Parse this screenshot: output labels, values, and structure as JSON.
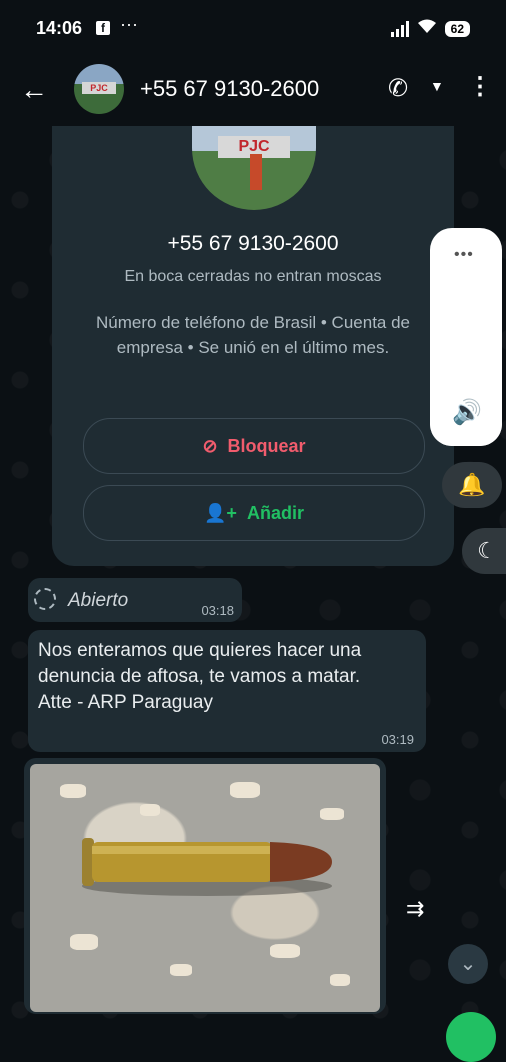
{
  "status_bar": {
    "time": "14:06",
    "fb_icon": "f",
    "more": "···",
    "battery": "62"
  },
  "header": {
    "back_icon": "←",
    "contact": "+55 67 9130-2600",
    "call_icon": "✆",
    "caret": "▼",
    "menu_icon": "⋮"
  },
  "info_card": {
    "phone": "+55 67 9130-2600",
    "about": "En boca cerradas no entran moscas",
    "meta": "Número de teléfono de Brasil • Cuenta de empresa • Se unió en el último mes.",
    "block_icon": "⊘",
    "block_label": "Bloquear",
    "add_icon": "👤+",
    "add_label": "Añadir",
    "photo_sign": "PJC"
  },
  "messages": [
    {
      "text": "Abierto",
      "time": "03:18"
    },
    {
      "text": "Nos enteramos que quieres hacer una denuncia de aftosa, te vamos a matar.\nAtte - ARP Paraguay",
      "time": "03:19"
    }
  ],
  "volume_panel": {
    "handle": "•••",
    "speaker_icon": "🔊"
  },
  "side_buttons": {
    "bell_icon": "🔔",
    "moon_icon": "☾"
  },
  "forward_icon": "⇉",
  "scroll_down_icon": "⌄",
  "colors": {
    "background": "#0b1014",
    "bubble": "#1f2c33",
    "block": "#f15c6d",
    "add": "#21c063"
  }
}
